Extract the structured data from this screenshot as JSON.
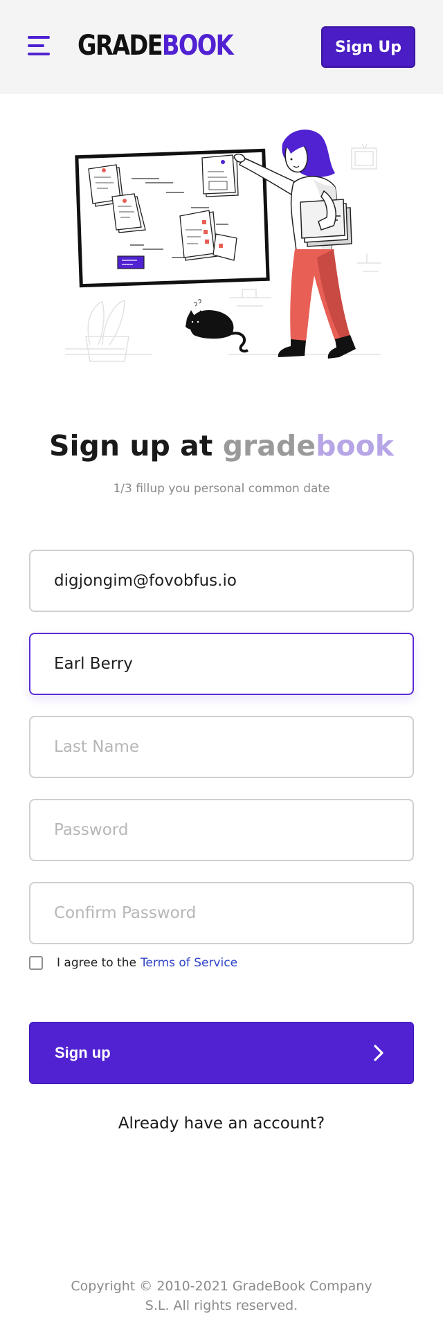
{
  "header": {
    "menu_icon": "hamburger-menu-icon",
    "logo_part1": "GRADE",
    "logo_part2": "BOOK",
    "signup_button": "Sign Up"
  },
  "hero": {
    "illustration": "woman-pinning-notes-on-board-with-cat-illustration"
  },
  "title": {
    "prefix": "Sign up at ",
    "brand_part1": "grade",
    "brand_part2": "book"
  },
  "subtitle": "1/3 fillup you personal common date",
  "form": {
    "email_value": "digjongim@fovobfus.io",
    "first_name_value": "Earl Berry",
    "last_name_placeholder": "Last Name",
    "password_placeholder": "Password",
    "confirm_password_placeholder": "Confirm Password",
    "terms_prefix": "I agree to the",
    "terms_link": "Terms of Service",
    "terms_checked": false,
    "submit_label": "Sign up",
    "submit_icon": "chevron-right-icon"
  },
  "login_prompt": "Already have an account?",
  "footer": {
    "line1": "Copyright © 2010-2021 GradeBook Company",
    "line2": "S.L. All rights reserved."
  },
  "colors": {
    "brand": "#5022d2",
    "brand_light": "#b6a6e6",
    "link": "#2f45c8",
    "accent_pants": "#e85f55"
  }
}
